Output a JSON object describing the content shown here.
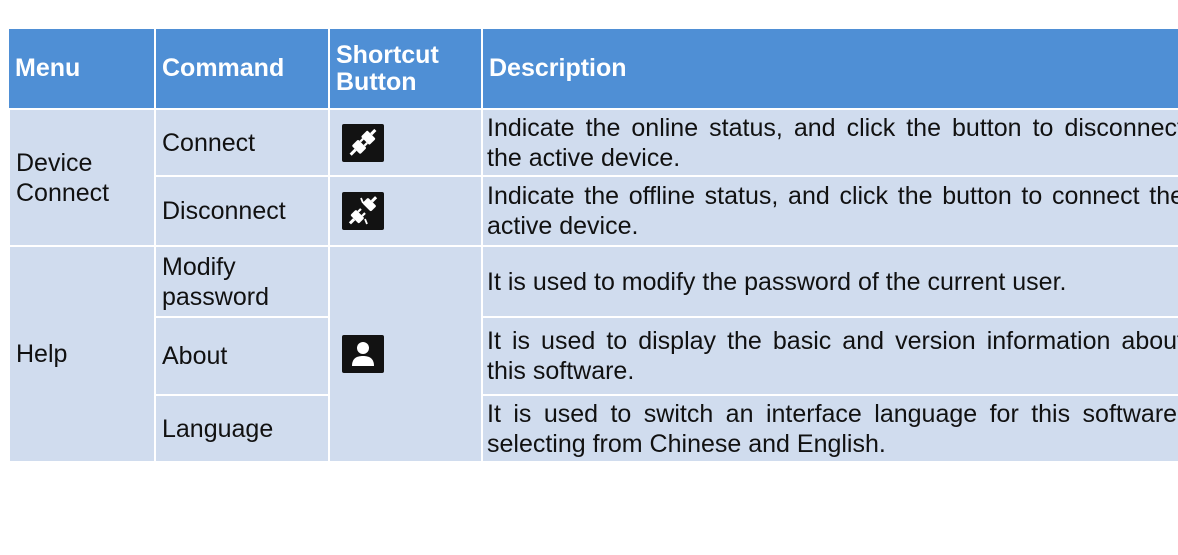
{
  "table": {
    "headers": {
      "menu": "Menu",
      "command": "Command",
      "shortcut_line1": "Shortcut",
      "shortcut_line2": "Button",
      "description": "Description"
    },
    "groups": [
      {
        "menu": "Device Connect",
        "rows": [
          {
            "command": "Connect",
            "icon": "plug-connected-icon",
            "description": "Indicate the online status, and click the button to disconnect the active device."
          },
          {
            "command": "Disconnect",
            "icon": "plug-disconnected-icon",
            "description": "Indicate the offline status, and click the button to connect the active device."
          }
        ]
      },
      {
        "menu": "Help",
        "shared_icon": "user-icon",
        "rows": [
          {
            "command": "Modify password",
            "description": "It is used to modify the password of the current user."
          },
          {
            "command": "About",
            "description": "It is used to display the basic and version information about this software."
          },
          {
            "command": "Language",
            "description": "It is used to switch an interface language for this software, selecting from Chinese and English."
          }
        ]
      }
    ]
  },
  "colors": {
    "header_bg": "#4f8fd5",
    "header_text": "#ffffff",
    "cell_bg": "#d0dcee",
    "icon_bg": "#121212"
  }
}
